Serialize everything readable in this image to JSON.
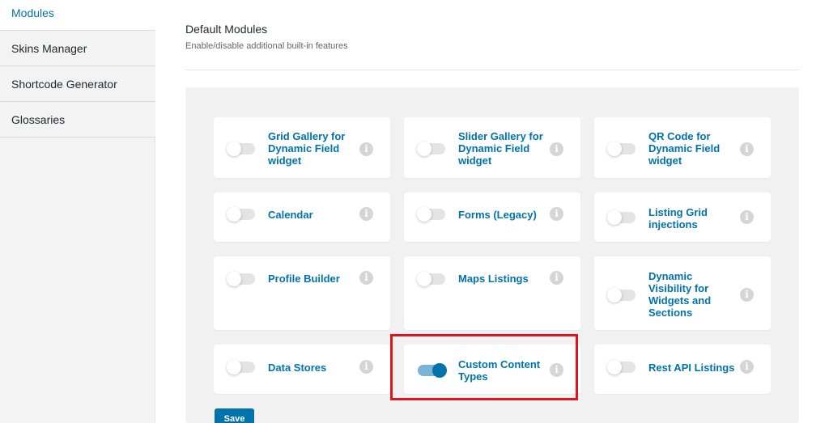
{
  "sidebar": {
    "items": [
      {
        "label": "Modules",
        "active": true
      },
      {
        "label": "Skins Manager",
        "active": false
      },
      {
        "label": "Shortcode Generator",
        "active": false
      },
      {
        "label": "Glossaries",
        "active": false
      }
    ]
  },
  "main": {
    "title": "Default Modules",
    "subtitle": "Enable/disable additional built-in features",
    "save_label": "Save"
  },
  "modules": [
    {
      "label": "Grid Gallery for Dynamic Field widget",
      "enabled": false
    },
    {
      "label": "Slider Gallery for Dynamic Field widget",
      "enabled": false
    },
    {
      "label": "QR Code for Dynamic Field widget",
      "enabled": false
    },
    {
      "label": "Calendar",
      "enabled": false
    },
    {
      "label": "Forms (Legacy)",
      "enabled": false
    },
    {
      "label": "Listing Grid injections",
      "enabled": false
    },
    {
      "label": "Profile Builder",
      "enabled": false
    },
    {
      "label": "Maps Listings",
      "enabled": false
    },
    {
      "label": "Dynamic Visibility for Widgets and Sections",
      "enabled": false
    },
    {
      "label": "Data Stores",
      "enabled": false
    },
    {
      "label": "Custom Content Types",
      "enabled": true
    },
    {
      "label": "Rest API Listings",
      "enabled": false
    }
  ],
  "info_glyph": "i",
  "colors": {
    "accent": "#0073aa",
    "highlight": "#e0141e"
  }
}
